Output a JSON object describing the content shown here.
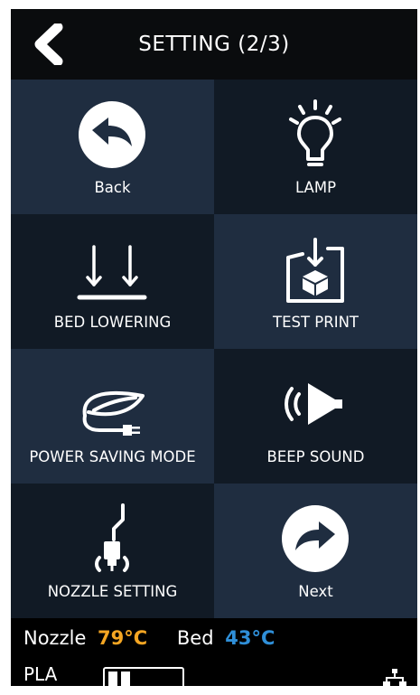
{
  "header": {
    "title": "SETTING (2/3)"
  },
  "tiles": [
    {
      "label": "Back",
      "icon": "back-arrow-icon"
    },
    {
      "label": "LAMP",
      "icon": "lightbulb-icon"
    },
    {
      "label": "BED LOWERING",
      "icon": "bed-lowering-icon"
    },
    {
      "label": "TEST PRINT",
      "icon": "test-print-icon"
    },
    {
      "label": "POWER SAVING MODE",
      "icon": "leaf-plug-icon"
    },
    {
      "label": "BEEP SOUND",
      "icon": "speaker-icon"
    },
    {
      "label": "NOZZLE SETTING",
      "icon": "nozzle-icon"
    },
    {
      "label": "Next",
      "icon": "next-arrow-icon"
    }
  ],
  "status": {
    "nozzle_label": "Nozzle",
    "nozzle_temp": "79°C",
    "bed_label": "Bed",
    "bed_temp": "43°C",
    "filament": "PLA",
    "network_icon": "network-icon"
  },
  "colors": {
    "tile_light": "#1f2d40",
    "tile_dark": "#111a25",
    "nozzle_temp": "#f5a623",
    "bed_temp": "#2f8fd8"
  }
}
